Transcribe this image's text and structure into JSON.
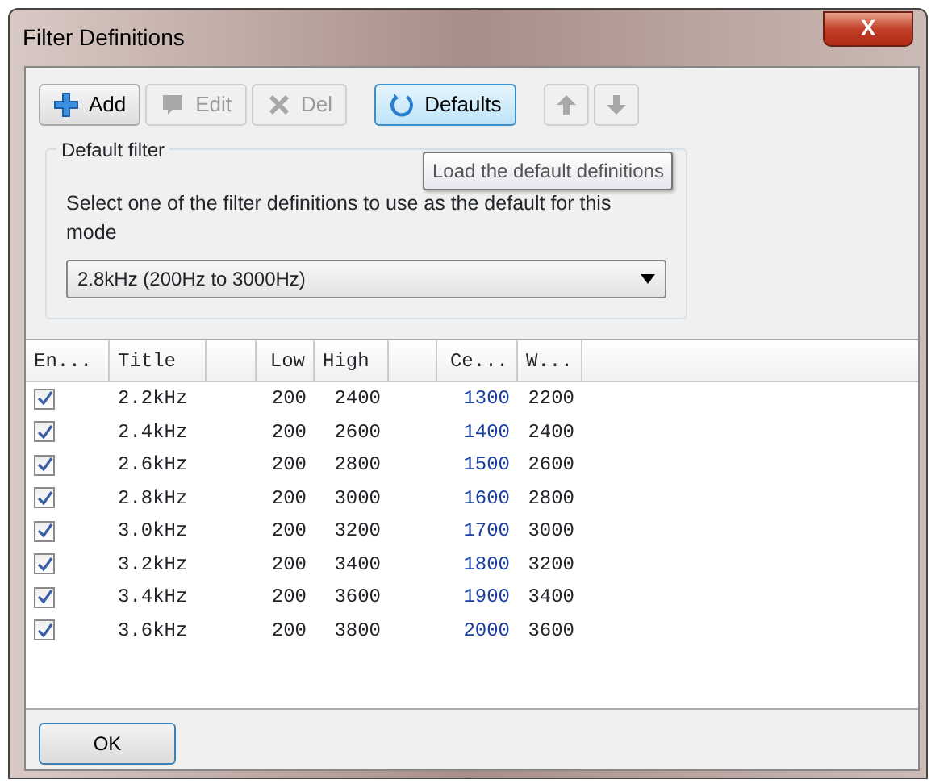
{
  "window": {
    "title": "Filter Definitions",
    "close": "X"
  },
  "toolbar": [
    {
      "kind": "add",
      "label": "Add",
      "disabled": false,
      "selected": false
    },
    {
      "kind": "edit",
      "label": "Edit",
      "disabled": true,
      "selected": false
    },
    {
      "kind": "delete",
      "label": "Del",
      "disabled": true,
      "selected": false
    },
    {
      "kind": "defaults",
      "label": "Defaults",
      "disabled": false,
      "selected": true
    },
    {
      "kind": "up",
      "disabled": true,
      "selected": false
    },
    {
      "kind": "down",
      "disabled": true,
      "selected": false
    }
  ],
  "tooltip": "Load the default definitions",
  "default_filter": {
    "legend": "Default filter",
    "description": "Select one of the filter definitions to use as the default for this mode",
    "value": "2.8kHz (200Hz to 3000Hz)"
  },
  "table": {
    "columns": [
      "En...",
      "Title",
      "",
      "Low",
      "High",
      "",
      "Ce...",
      "W..."
    ],
    "rows": [
      {
        "enabled": true,
        "cells": [
          "",
          "2.2kHz",
          "",
          "200",
          "2400",
          "",
          "1300",
          "2200"
        ]
      },
      {
        "enabled": true,
        "cells": [
          "",
          "2.4kHz",
          "",
          "200",
          "2600",
          "",
          "1400",
          "2400"
        ]
      },
      {
        "enabled": true,
        "cells": [
          "",
          "2.6kHz",
          "",
          "200",
          "2800",
          "",
          "1500",
          "2600"
        ]
      },
      {
        "enabled": true,
        "cells": [
          "",
          "2.8kHz",
          "",
          "200",
          "3000",
          "",
          "1600",
          "2800"
        ]
      },
      {
        "enabled": true,
        "cells": [
          "",
          "3.0kHz",
          "",
          "200",
          "3200",
          "",
          "1700",
          "3000"
        ]
      },
      {
        "enabled": true,
        "cells": [
          "",
          "3.2kHz",
          "",
          "200",
          "3400",
          "",
          "1800",
          "3200"
        ]
      },
      {
        "enabled": true,
        "cells": [
          "",
          "3.4kHz",
          "",
          "200",
          "3600",
          "",
          "1900",
          "3400"
        ]
      },
      {
        "enabled": true,
        "cells": [
          "",
          "3.6kHz",
          "",
          "200",
          "3800",
          "",
          "2000",
          "3600"
        ]
      }
    ]
  },
  "buttons": [
    "OK"
  ]
}
